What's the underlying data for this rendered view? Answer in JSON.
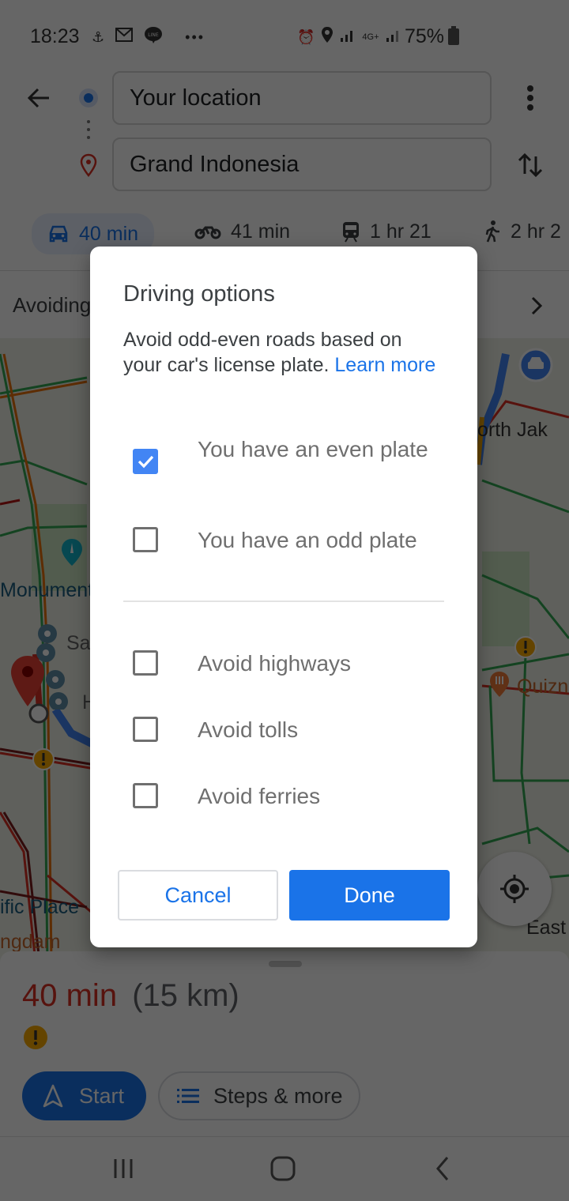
{
  "status_bar": {
    "time": "18:23",
    "left_icons": [
      "notification-app-icon",
      "gmail-icon",
      "line-icon",
      "more-notifications-icon"
    ],
    "line_label": "LINE",
    "network_label": "4G+",
    "battery_percent": "75%"
  },
  "header": {
    "origin_value": "Your location",
    "destination_value": "Grand Indonesia"
  },
  "travel_modes": [
    {
      "icon": "car-icon",
      "label": "40 min",
      "selected": true
    },
    {
      "icon": "motorcycle-icon",
      "label": "41 min",
      "selected": false
    },
    {
      "icon": "transit-icon",
      "label": "1 hr 21",
      "selected": false
    },
    {
      "icon": "walk-icon",
      "label": "2 hr 2"
    }
  ],
  "avoid_row": {
    "label": "Avoiding"
  },
  "map": {
    "labels": [
      "Monument",
      "Sa",
      "H",
      "orth Jak",
      "Quizno",
      "ific Place",
      "ngdam",
      "East"
    ]
  },
  "route_sheet": {
    "eta_time": "40 min",
    "eta_distance": "(15 km)",
    "start_label": "Start",
    "steps_label": "Steps & more"
  },
  "dialog": {
    "title": "Driving options",
    "description": "Avoid odd-even roads based on your car's license plate.",
    "learn_more": "Learn more",
    "plate_options": [
      {
        "label": "You have an even plate",
        "checked": true
      },
      {
        "label": "You have an odd plate",
        "checked": false
      }
    ],
    "avoid_options": [
      {
        "label": "Avoid highways",
        "checked": false
      },
      {
        "label": "Avoid tolls",
        "checked": false
      },
      {
        "label": "Avoid ferries",
        "checked": false
      }
    ],
    "cancel_label": "Cancel",
    "done_label": "Done"
  },
  "colors": {
    "accent": "#1a73e8",
    "checkbox_checked": "#4285f4",
    "eta_red": "#d93025",
    "warning_yellow": "#f9ab00"
  }
}
